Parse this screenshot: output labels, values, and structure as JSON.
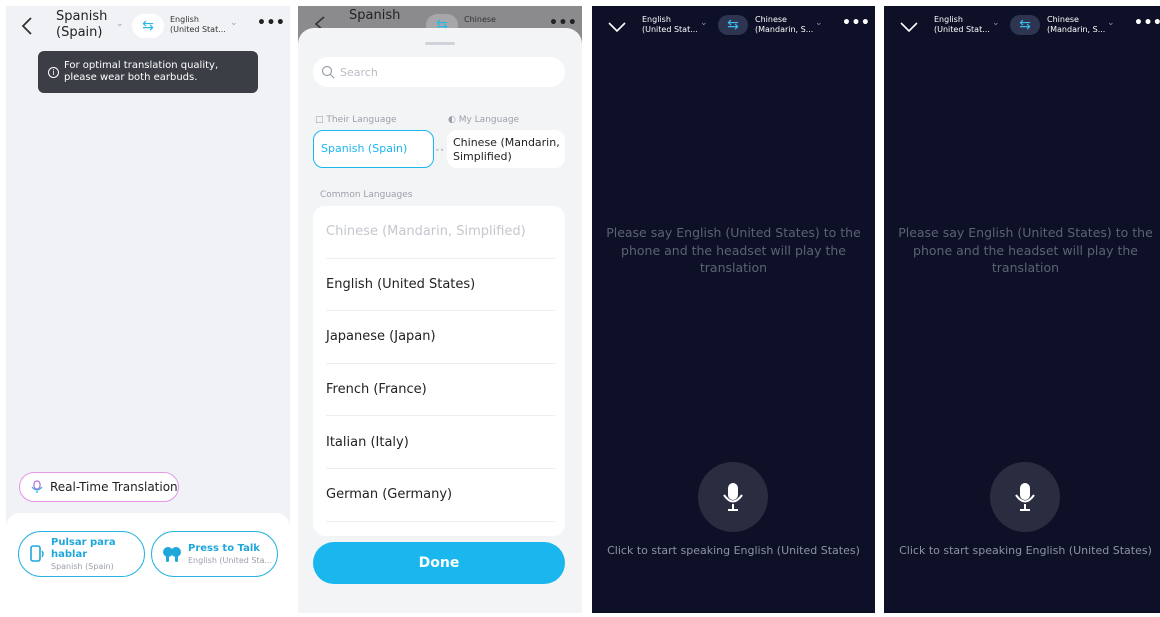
{
  "panel1": {
    "source_lang_line1": "Spanish",
    "source_lang_line2": "(Spain)",
    "target_lang_line1": "English",
    "target_lang_line2": "(United Stat...",
    "tooltip": "For optimal translation quality, please wear both earbuds.",
    "realtime_label": "Real-Time Translation",
    "left_button": {
      "title_line1": "Pulsar para",
      "title_line2": "hablar",
      "subtitle": "Spanish (Spain)"
    },
    "right_button": {
      "title": "Press to Talk",
      "subtitle": "English (United Sta..."
    }
  },
  "panel2": {
    "header_source": "Spanish",
    "header_target": "Chinese",
    "search_placeholder": "Search",
    "their_language_label": "Their Language",
    "my_language_label": "My Language",
    "their_language": "Spanish (Spain)",
    "my_language_line1": "Chinese (Mandarin,",
    "my_language_line2": "Simplified)",
    "common_label": "Common Languages",
    "languages": [
      "Chinese (Mandarin, Simplified)",
      "English (United States)",
      "Japanese (Japan)",
      "French (France)",
      "Italian (Italy)",
      "German (Germany)"
    ],
    "done_label": "Done"
  },
  "dark": {
    "left_lang_line1": "English",
    "left_lang_line2": "(United Stat...",
    "right_lang_line1": "Chinese",
    "right_lang_line2": "(Mandarin, S...",
    "prompt": "Please say English (United States) to the phone and the headset will play the translation",
    "click_hint": "Click to start speaking English (United States)"
  },
  "colors": {
    "accent": "#1ab6ee",
    "dark_bg": "#0d1027",
    "rtt_border": "#e398e8"
  },
  "icons": [
    "back-arrow-icon",
    "swap-icon",
    "more-icon",
    "info-icon",
    "microphone-icon",
    "phone-icon",
    "earbuds-icon",
    "search-icon",
    "chevron-down-icon"
  ]
}
